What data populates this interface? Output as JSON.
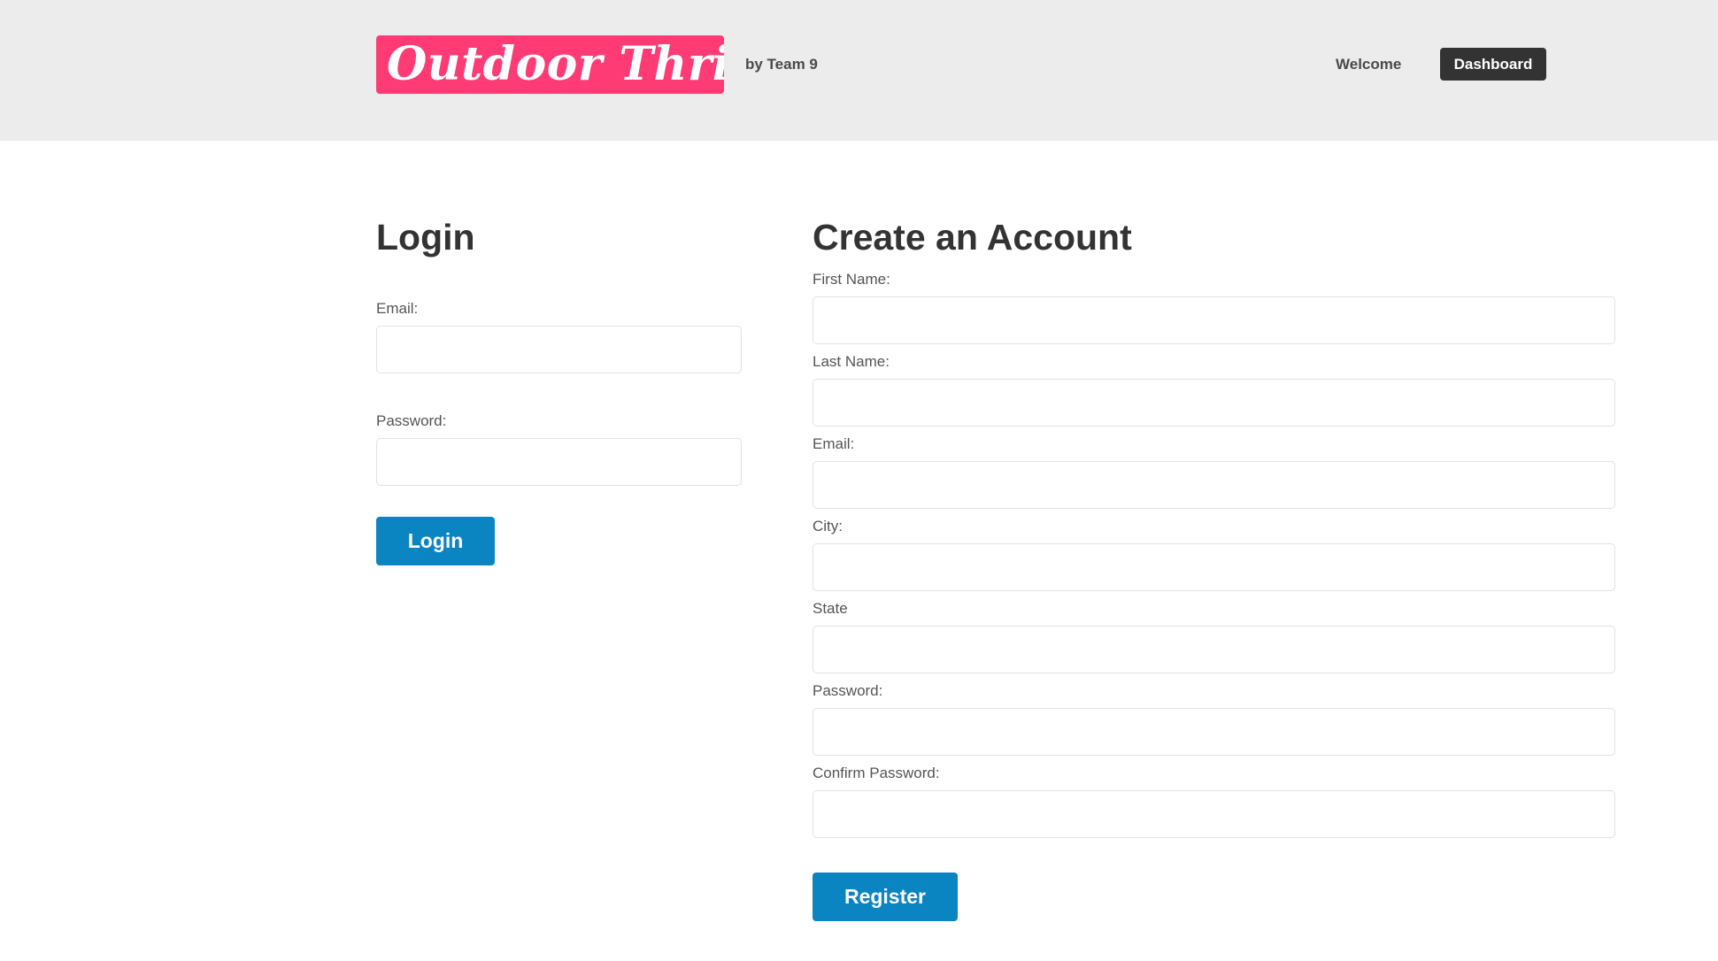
{
  "header": {
    "logo_text": "Outdoor Thrills",
    "byline": "by Team 9",
    "nav": {
      "welcome_label": "Welcome",
      "dashboard_label": "Dashboard"
    }
  },
  "login": {
    "title": "Login",
    "email_label": "Email:",
    "email_value": "",
    "password_label": "Password:",
    "password_value": "",
    "submit_label": "Login"
  },
  "register": {
    "title": "Create an Account",
    "first_name_label": "First Name:",
    "last_name_label": "Last Name:",
    "email_label": "Email:",
    "city_label": "City:",
    "state_label": "State",
    "password_label": "Password:",
    "confirm_password_label": "Confirm Password:",
    "submit_label": "Register"
  },
  "colors": {
    "logo_bg": "#fe3b74",
    "header_bg": "#ececec",
    "primary_button": "#0a85c2",
    "dark_button": "#333333"
  }
}
